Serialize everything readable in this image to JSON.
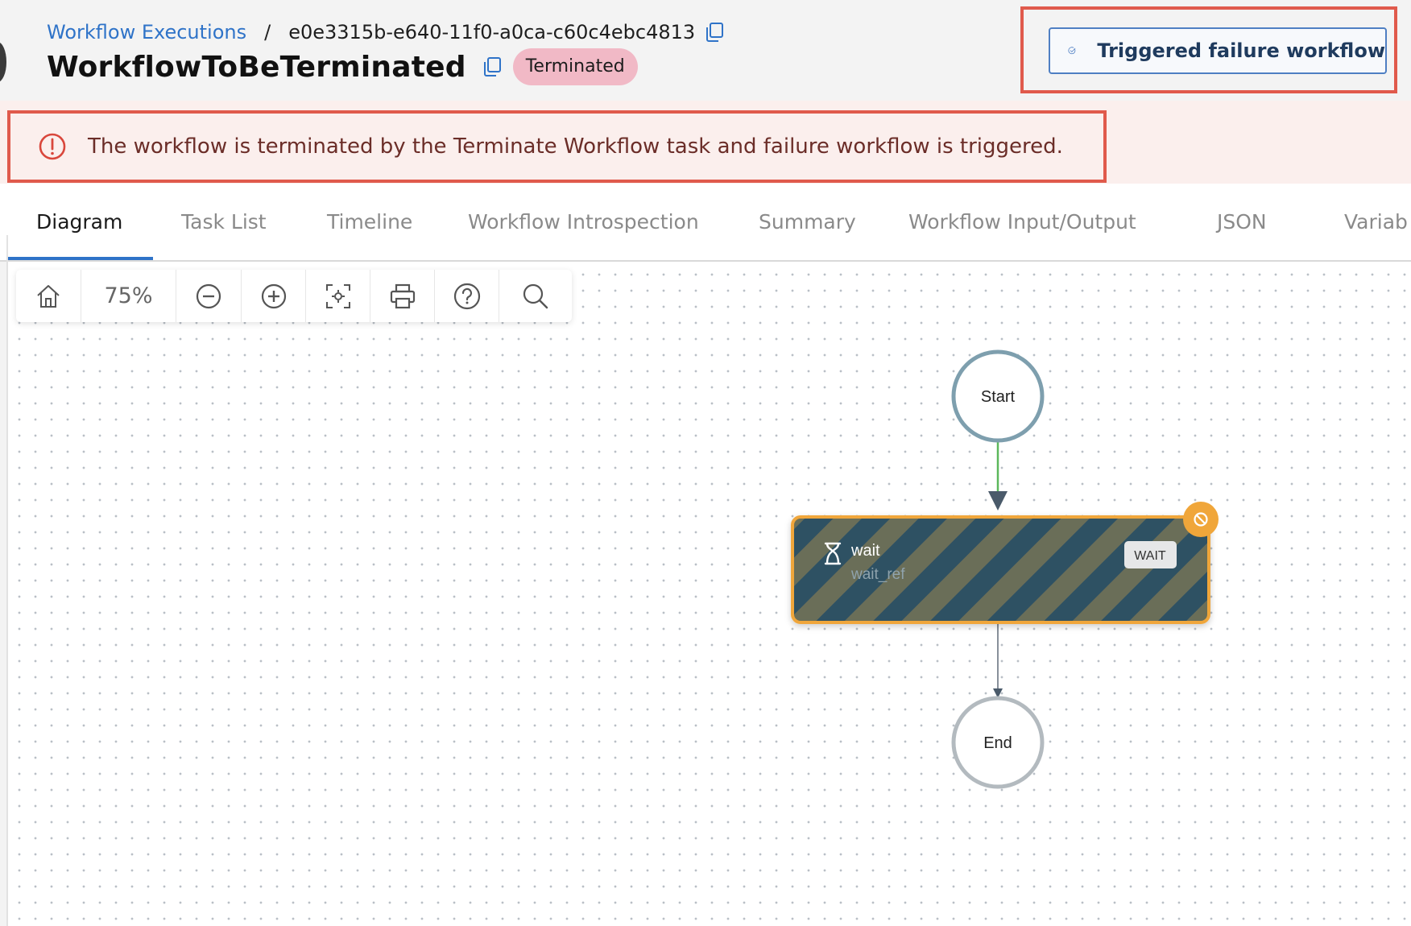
{
  "breadcrumb": {
    "parent_label": "Workflow Executions",
    "separator": "/",
    "execution_id": "e0e3315b-e640-11f0-a0ca-c60c4ebc4813"
  },
  "header": {
    "title": "WorkflowToBeTerminated",
    "status": "Terminated"
  },
  "trigger_button": {
    "label": "Triggered failure workflow"
  },
  "alert": {
    "message": "The workflow is terminated by the Terminate Workflow task and failure workflow is triggered."
  },
  "tabs": [
    {
      "label": "Diagram",
      "active": true
    },
    {
      "label": "Task List",
      "active": false
    },
    {
      "label": "Timeline",
      "active": false
    },
    {
      "label": "Workflow Introspection",
      "active": false
    },
    {
      "label": "Summary",
      "active": false
    },
    {
      "label": "Workflow Input/Output",
      "active": false
    },
    {
      "label": "JSON",
      "active": false
    },
    {
      "label": "Variab",
      "active": false
    }
  ],
  "toolbar": {
    "zoom_level": "75%",
    "icons": [
      "home-icon",
      "zoom-out-icon",
      "zoom-in-icon",
      "fit-view-icon",
      "print-icon",
      "help-icon",
      "search-icon"
    ]
  },
  "graph": {
    "start_label": "Start",
    "end_label": "End",
    "task": {
      "name": "wait",
      "ref": "wait_ref",
      "type_badge": "WAIT",
      "icon": "hourglass-icon",
      "status_icon": "cancelled-icon"
    }
  },
  "colors": {
    "link_blue": "#2f73c8",
    "status_badge": "#f1b9c6",
    "highlight_red": "#e05a4c",
    "alert_text": "#6b2d28",
    "node_dark": "#2f5164",
    "node_stripe": "#6b6e58",
    "node_border": "#f0a63a",
    "start_ring": "#7e9fae",
    "end_ring": "#b3babf",
    "edge_green": "#5cb85c"
  }
}
